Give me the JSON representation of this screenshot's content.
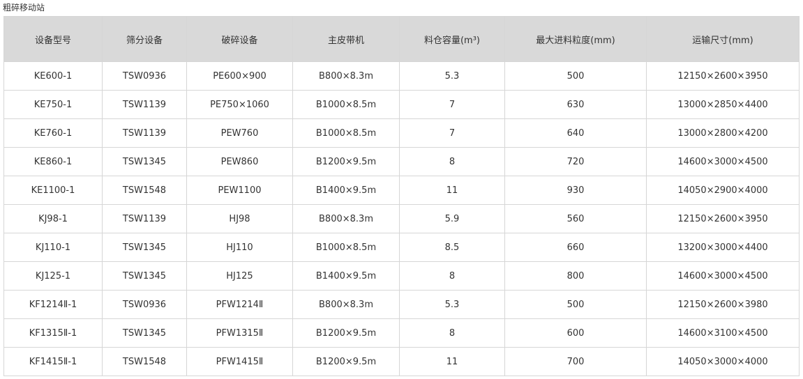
{
  "caption": "粗碎移动站",
  "table": {
    "headers": [
      "设备型号",
      "筛分设备",
      "破碎设备",
      "主皮带机",
      "料仓容量(m³)",
      "最大进料粒度(mm)",
      "运输尺寸(mm)"
    ],
    "rows": [
      [
        "KE600-1",
        "TSW0936",
        "PE600×900",
        "B800×8.3m",
        "5.3",
        "500",
        "12150×2600×3950"
      ],
      [
        "KE750-1",
        "TSW1139",
        "PE750×1060",
        "B1000×8.5m",
        "7",
        "630",
        "13000×2850×4400"
      ],
      [
        "KE760-1",
        "TSW1139",
        "PEW760",
        "B1000×8.5m",
        "7",
        "640",
        "13000×2800×4200"
      ],
      [
        "KE860-1",
        "TSW1345",
        "PEW860",
        "B1200×9.5m",
        "8",
        "720",
        "14600×3000×4500"
      ],
      [
        "KE1100-1",
        "TSW1548",
        "PEW1100",
        "B1400×9.5m",
        "11",
        "930",
        "14050×2900×4000"
      ],
      [
        "KJ98-1",
        "TSW1139",
        "HJ98",
        "B800×8.3m",
        "5.9",
        "560",
        "12150×2600×3950"
      ],
      [
        "KJ110-1",
        "TSW1345",
        "HJ110",
        "B1000×8.5m",
        "8.5",
        "660",
        "13200×3000×4400"
      ],
      [
        "KJ125-1",
        "TSW1345",
        "HJ125",
        "B1400×9.5m",
        "8",
        "800",
        "14600×3000×4500"
      ],
      [
        "KF1214Ⅱ-1",
        "TSW0936",
        "PFW1214Ⅱ",
        "B800×8.3m",
        "5.3",
        "500",
        "12150×2600×3980"
      ],
      [
        "KF1315Ⅱ-1",
        "TSW1345",
        "PFW1315Ⅱ",
        "B1200×9.5m",
        "8",
        "600",
        "14600×3100×4500"
      ],
      [
        "KF1415Ⅱ-1",
        "TSW1548",
        "PFW1415Ⅱ",
        "B1200×9.5m",
        "11",
        "700",
        "14050×3000×4000"
      ]
    ]
  }
}
